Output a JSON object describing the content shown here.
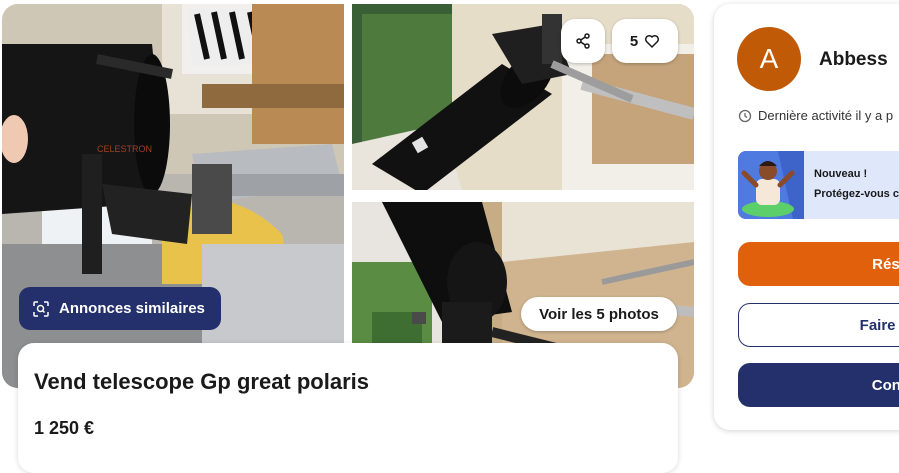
{
  "gallery": {
    "share_icon": "share-icon",
    "favorites_count": "5",
    "heart_icon": "heart-icon",
    "similar_ads_label": "Annonces similaires",
    "view_photos_label": "Voir les 5 photos",
    "brand_label_photo1": "CELESTRON"
  },
  "listing": {
    "title": "Vend telescope Gp great polaris",
    "price": "1 250 €"
  },
  "seller": {
    "avatar_initial": "A",
    "name": "Abbess",
    "last_activity": "Dernière activité il y a p",
    "promo_new": "Nouveau !",
    "promo_text": "Protégez-vous c",
    "reserve_label": "Réser",
    "offer_label": "Faire une",
    "contact_label": "Conta"
  },
  "colors": {
    "accent_orange": "#e0600b",
    "brand_navy": "#24306b",
    "avatar": "#c05a06",
    "promo_bg": "#dfe8fb"
  }
}
